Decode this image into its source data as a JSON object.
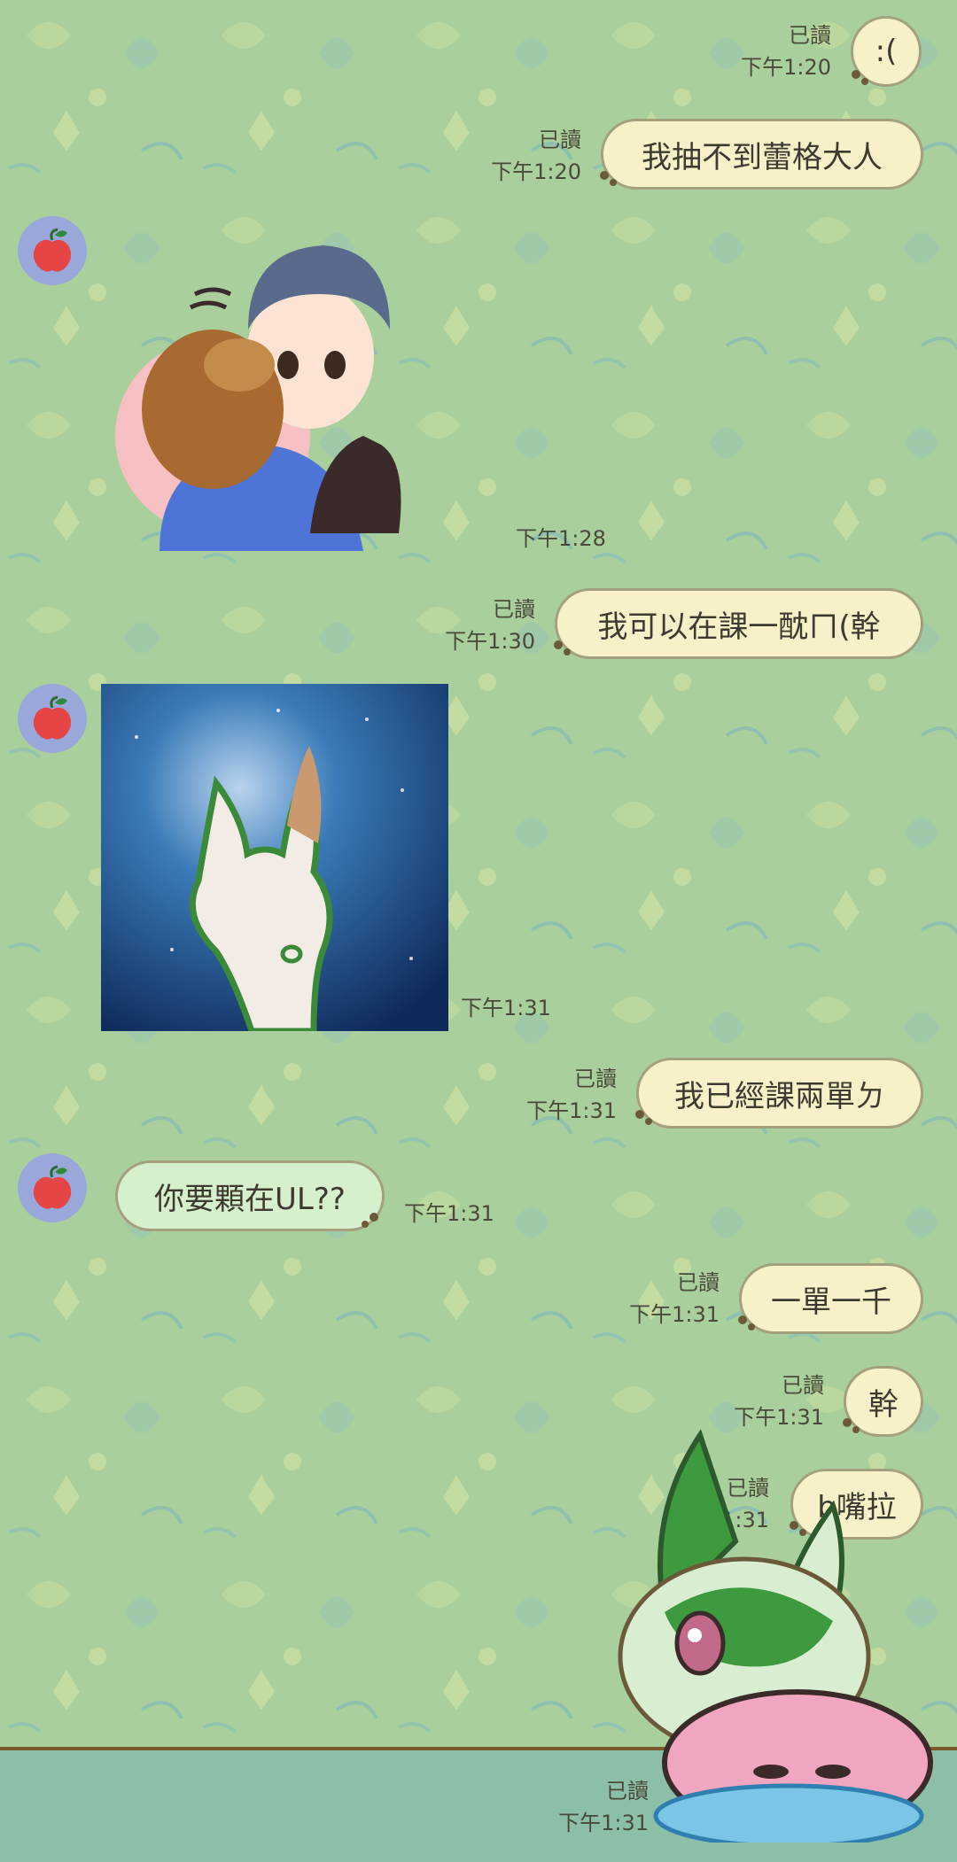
{
  "messages": [
    {
      "type": "text",
      "from": "me",
      "text": ":(",
      "read": "已讀",
      "time": "下午1:20"
    },
    {
      "type": "text",
      "from": "me",
      "text": "我抽不到蕾格大人",
      "read": "已讀",
      "time": "下午1:20"
    },
    {
      "type": "sticker",
      "from": "them",
      "time": "下午1:28"
    },
    {
      "type": "text",
      "from": "me",
      "text": "我可以在課一酖ㄇ(幹",
      "read": "已讀",
      "time": "下午1:30"
    },
    {
      "type": "image",
      "from": "them",
      "time": "下午1:31"
    },
    {
      "type": "text",
      "from": "me",
      "text": "我已經課兩單ㄉ",
      "read": "已讀",
      "time": "下午1:31"
    },
    {
      "type": "text",
      "from": "them",
      "text": "你要顆在UL??",
      "time": "下午1:31"
    },
    {
      "type": "text",
      "from": "me",
      "text": "一單一千",
      "read": "已讀",
      "time": "下午1:31"
    },
    {
      "type": "text",
      "from": "me",
      "text": "幹",
      "read": "已讀",
      "time": "下午1:31"
    },
    {
      "type": "text",
      "from": "me",
      "text": "b嘴拉",
      "read": "已讀",
      "time": "下午1:31"
    },
    {
      "type": "sticker",
      "from": "me",
      "read": "已讀",
      "time": "下午1:31"
    }
  ],
  "colors": {
    "background": "#a9cf9c",
    "bubble_mine": "#f6f1c9",
    "bubble_theirs": "#d6efcd",
    "avatar": "#9aa7da"
  },
  "icons": {
    "avatar": "apple-icon"
  }
}
